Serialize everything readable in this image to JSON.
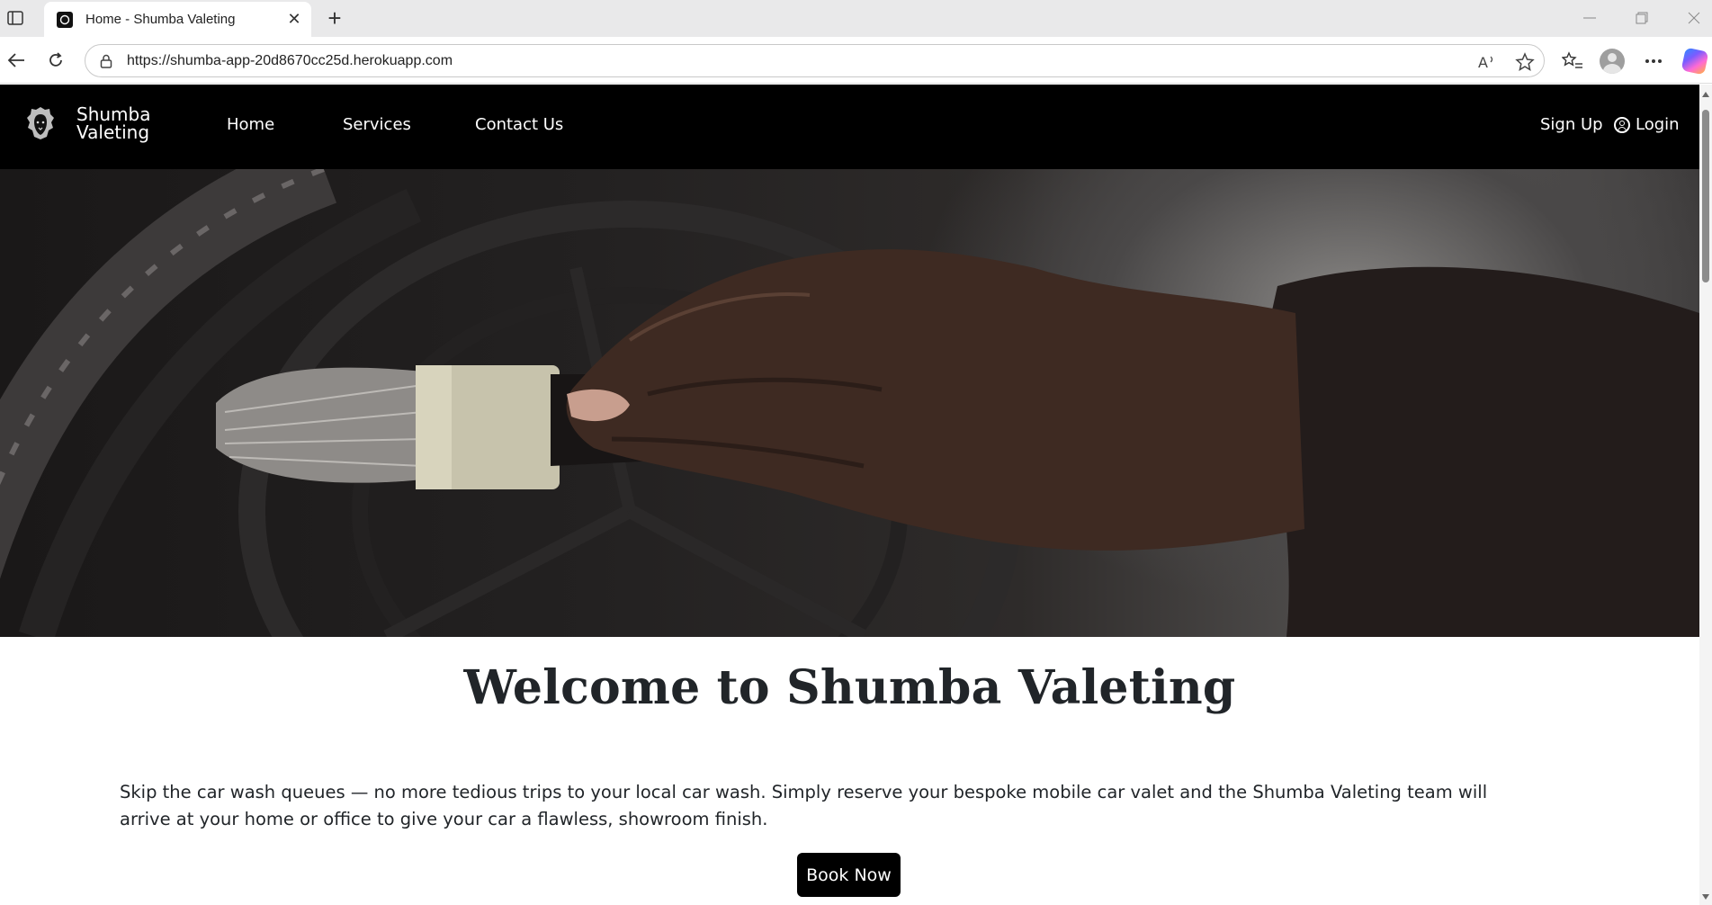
{
  "browser": {
    "tab_title": "Home - Shumba Valeting",
    "url": "https://shumba-app-20d8670cc25d.herokuapp.com",
    "icons": [
      "sidebar-icon",
      "close-icon",
      "plus-icon",
      "minimize-icon",
      "restore-icon",
      "window-close-icon",
      "back-icon",
      "refresh-icon",
      "lock-icon",
      "read-aloud-icon",
      "favorite-star-icon",
      "favorites-icon",
      "profile-icon",
      "more-icon",
      "copilot-icon"
    ]
  },
  "site": {
    "brand_line1": "Shumba",
    "brand_line2": "Valeting",
    "nav": {
      "home": "Home",
      "services": "Services",
      "contact": "Contact Us",
      "signup": "Sign Up",
      "login": "Login"
    },
    "welcome": "Welcome to Shumba Valeting",
    "intro": "Skip the car wash queues — no more tedious trips to your local car wash. Simply reserve your bespoke mobile car valet and the Shumba Valeting team will arrive at your home or office to give your car a flawless, showroom finish.",
    "cta": "Book Now"
  },
  "colors": {
    "navbar_bg": "#000000",
    "button_bg": "#000000",
    "text": "#212529"
  }
}
